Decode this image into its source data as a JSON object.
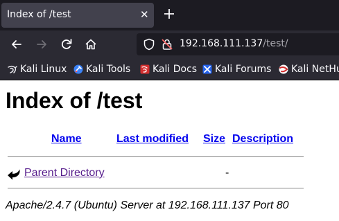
{
  "browser": {
    "tab": {
      "title": "Index of /test",
      "close_symbol": "✕"
    },
    "url": {
      "host": "192.168.111.137",
      "path": "/test/"
    },
    "bookmarks": [
      {
        "label": "Kali Linux",
        "icon": "kali-dragon-icon"
      },
      {
        "label": "Kali Tools",
        "icon": "kali-tools-icon"
      },
      {
        "label": "Kali Docs",
        "icon": "kali-docs-icon"
      },
      {
        "label": "Kali Forums",
        "icon": "kali-forums-icon"
      },
      {
        "label": "Kali NetHu",
        "icon": "kali-nethunter-icon"
      }
    ]
  },
  "page": {
    "heading": "Index of /test",
    "columns": {
      "name": "Name",
      "last_modified": "Last modified",
      "size": "Size",
      "description": "Description"
    },
    "rows": [
      {
        "name": "Parent Directory",
        "last_modified": "",
        "size": "-",
        "description": "",
        "icon": "back-arrow-icon"
      }
    ],
    "address": "Apache/2.4.7 (Ubuntu) Server at 192.168.111.137 Port 80"
  },
  "colors": {
    "link": "#0000ee",
    "visited_link": "#551a8b",
    "chrome_dark": "#1c1b22",
    "chrome": "#2b2a33"
  }
}
